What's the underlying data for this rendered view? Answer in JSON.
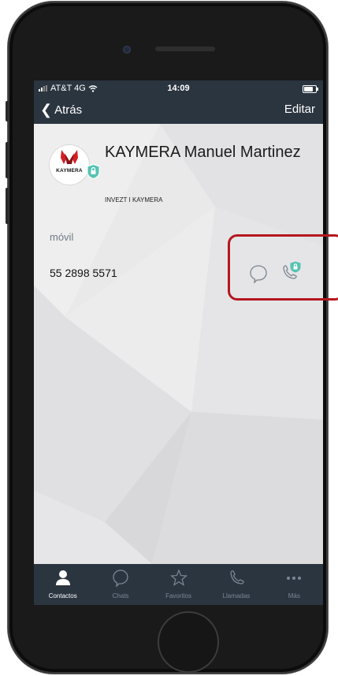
{
  "status_bar": {
    "carrier": "AT&T 4G",
    "time": "14:09"
  },
  "nav": {
    "back_label": "Atrás",
    "edit_label": "Editar"
  },
  "contact": {
    "name": "KAYMERA Manuel Martinez",
    "company": "INVEZT I KAYMERA",
    "avatar_brand": "KAYMERA"
  },
  "phone_field": {
    "label": "móvil",
    "number": "55 2898 5571"
  },
  "tabbar": {
    "items": [
      {
        "label": "Contactos",
        "icon": "person-icon",
        "active": true
      },
      {
        "label": "Chats",
        "icon": "chat-bubble-icon",
        "active": false
      },
      {
        "label": "Favoritos",
        "icon": "star-icon",
        "active": false
      },
      {
        "label": "Llamadas",
        "icon": "phone-icon",
        "active": false
      },
      {
        "label": "Más",
        "icon": "more-dots-icon",
        "active": false
      }
    ]
  },
  "colors": {
    "nav_bg": "#2b3540",
    "accent_teal": "#55c3b3",
    "highlight_red": "#b3181f",
    "avatar_red": "#d21f26"
  },
  "icons": {
    "chat": "chat-bubble-icon",
    "secure_call": "secure-call-icon",
    "badge": "lock-badge-icon"
  }
}
